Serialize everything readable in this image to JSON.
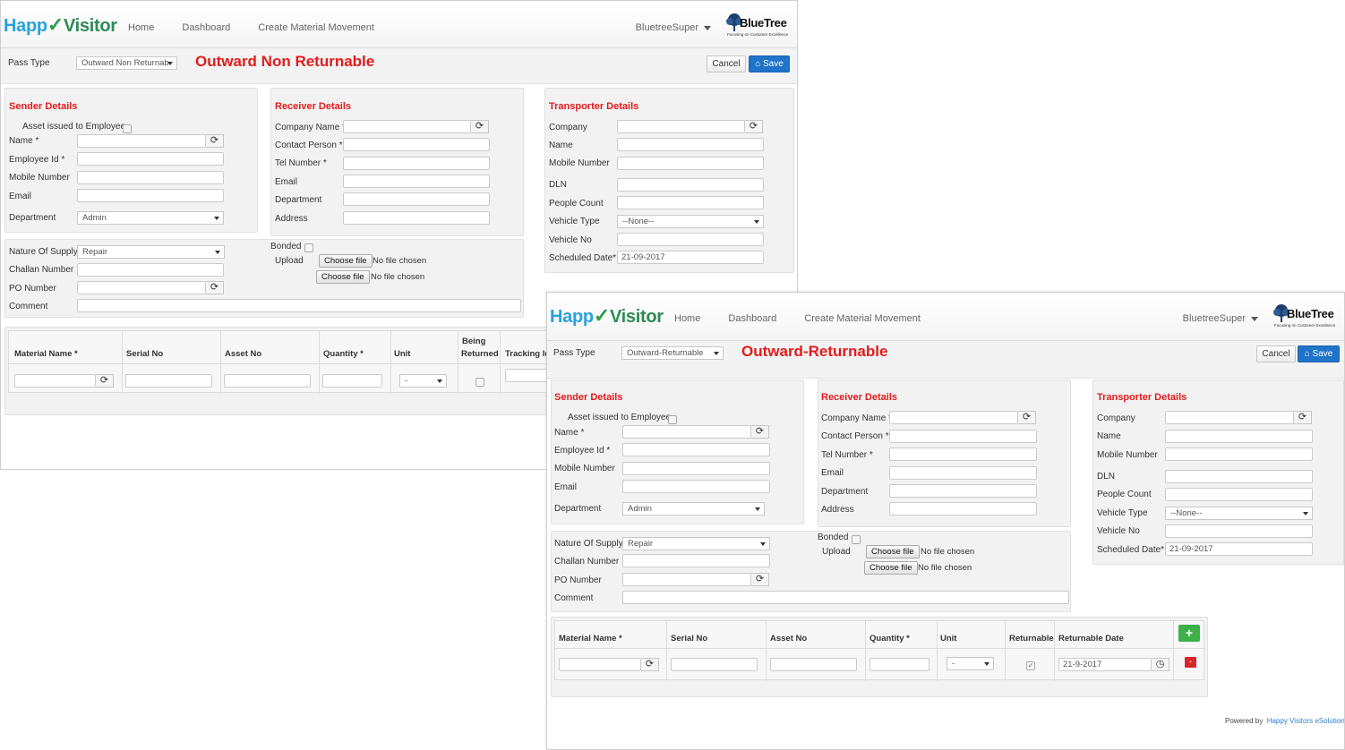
{
  "win1": {
    "logo": {
      "part1": "Happ",
      "part2": "Visitor"
    },
    "nav": [
      "Home",
      "Dashboard",
      "Create Material Movement"
    ],
    "user": "BluetreeSuper",
    "brand": {
      "name": "BlueTree",
      "tagline": "Focusing on Customer Excellence"
    },
    "pass_type_label": "Pass Type",
    "pass_type_value": "Outward Non Returnab",
    "pass_title": "Outward Non Returnable",
    "cancel": "Cancel",
    "save": "Save",
    "sender": {
      "title": "Sender Details",
      "asset_issued": "Asset issued to Employee",
      "name": "Name *",
      "employee_id": "Employee Id *",
      "mobile": "Mobile Number",
      "email": "Email",
      "department": "Department",
      "department_value": "Admin"
    },
    "receiver": {
      "title": "Receiver Details",
      "company": "Company Name *",
      "contact": "Contact Person *",
      "tel": "Tel Number *",
      "email": "Email",
      "department": "Department",
      "address": "Address"
    },
    "transporter": {
      "title": "Transporter Details",
      "company": "Company",
      "name": "Name",
      "mobile": "Mobile Number",
      "dln": "DLN",
      "people": "People Count",
      "vehicle_type": "Vehicle Type",
      "vehicle_type_value": "--None--",
      "vehicle_no": "Vehicle No",
      "scheduled": "Scheduled Date*",
      "scheduled_value": "21-09-2017"
    },
    "supply": {
      "nature": "Nature Of Supply",
      "nature_value": "Repair",
      "challan": "Challan Number",
      "po": "PO Number",
      "comment": "Comment",
      "bonded": "Bonded",
      "upload": "Upload",
      "choose_file": "Choose file",
      "no_file": "No file chosen"
    },
    "table": {
      "headers": [
        "Material Name *",
        "Serial No",
        "Asset No",
        "Quantity *",
        "Unit",
        "Being",
        "Returned",
        "Tracking Id"
      ],
      "unit_value": "-"
    }
  },
  "win2": {
    "logo": {
      "part1": "Happ",
      "part2": "Visitor"
    },
    "nav": [
      "Home",
      "Dashboard",
      "Create Material Movement"
    ],
    "user": "BluetreeSuper",
    "brand": {
      "name": "BlueTree",
      "tagline": "Focusing on Customer Excellence"
    },
    "pass_type_label": "Pass Type",
    "pass_type_value": "Outward-Returnable",
    "pass_title": "Outward-Returnable",
    "cancel": "Cancel",
    "save": "Save",
    "sender": {
      "title": "Sender Details",
      "asset_issued": "Asset issued to Employee",
      "name": "Name *",
      "employee_id": "Employee Id *",
      "mobile": "Mobile Number",
      "email": "Email",
      "department": "Department",
      "department_value": "Admin"
    },
    "receiver": {
      "title": "Receiver Details",
      "company": "Company Name *",
      "contact": "Contact Person *",
      "tel": "Tel Number *",
      "email": "Email",
      "department": "Department",
      "address": "Address"
    },
    "transporter": {
      "title": "Transporter Details",
      "company": "Company",
      "name": "Name",
      "mobile": "Mobile Number",
      "dln": "DLN",
      "people": "People Count",
      "vehicle_type": "Vehicle Type",
      "vehicle_type_value": "--None--",
      "vehicle_no": "Vehicle No",
      "scheduled": "Scheduled Date*",
      "scheduled_value": "21-09-2017"
    },
    "supply": {
      "nature": "Nature Of Supply",
      "nature_value": "Repair",
      "challan": "Challan Number",
      "po": "PO Number",
      "comment": "Comment",
      "bonded": "Bonded",
      "upload": "Upload",
      "choose_file": "Choose file",
      "no_file": "No file chosen"
    },
    "table": {
      "headers": [
        "Material Name *",
        "Serial No",
        "Asset No",
        "Quantity *",
        "Unit",
        "Returnable",
        "Returnable Date"
      ],
      "unit_value": "-",
      "returnable_date_value": "21-9-2017",
      "add": "+",
      "remove": "-"
    },
    "footer": {
      "powered_by": "Powered by",
      "company": "Happy Visitors eSolutions"
    }
  },
  "colors": {
    "accent_red": "#e21c1c",
    "save_blue": "#1f73c9",
    "add_green": "#3db049",
    "logo_blue": "#29a3dc"
  },
  "icons": [
    "refresh-icon",
    "home-icon",
    "clock-icon",
    "caret-down-icon",
    "tree-logo-icon"
  ]
}
